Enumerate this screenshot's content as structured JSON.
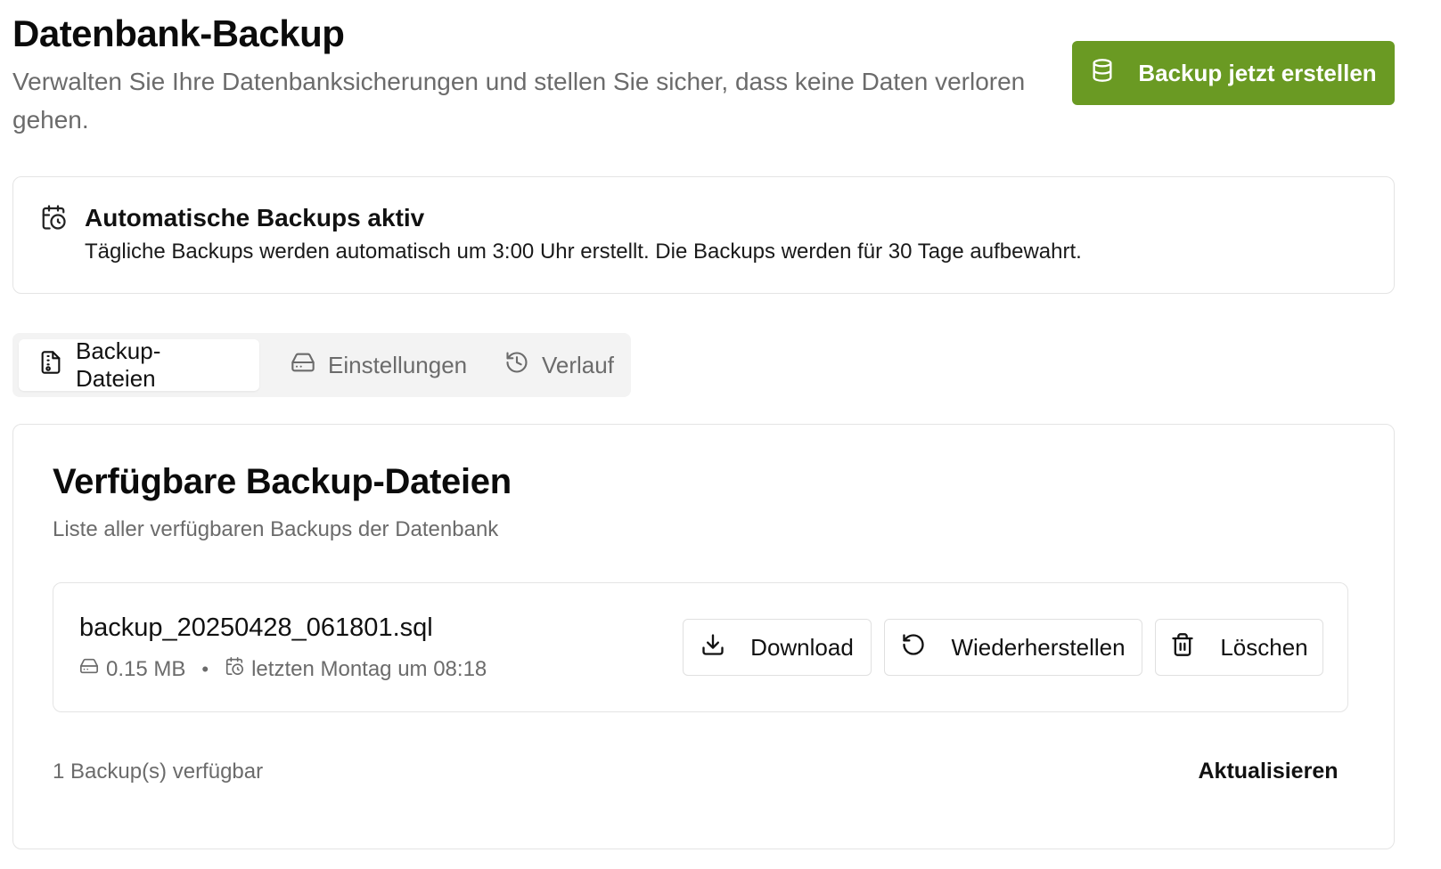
{
  "header": {
    "title": "Datenbank-Backup",
    "subtitle": "Verwalten Sie Ihre Datenbanksicherungen und stellen Sie sicher, dass keine Daten verloren gehen.",
    "create_button_label": "Backup jetzt erstellen",
    "create_button_icon": "database-icon",
    "accent_color": "#6a9a23"
  },
  "info": {
    "icon": "calendar-clock-icon",
    "title": "Automatische Backups aktiv",
    "text": "Tägliche Backups werden automatisch um 3:00 Uhr erstellt. Die Backups werden für 30 Tage aufbewahrt."
  },
  "tabs": [
    {
      "label": "Backup-Dateien",
      "icon": "file-archive-icon",
      "active": true
    },
    {
      "label": "Einstellungen",
      "icon": "hard-drive-icon",
      "active": false
    },
    {
      "label": "Verlauf",
      "icon": "history-icon",
      "active": false
    }
  ],
  "main": {
    "title": "Verfügbare Backup-Dateien",
    "subtitle": "Liste aller verfügbaren Backups der Datenbank",
    "files": [
      {
        "name": "backup_20250428_061801.sql",
        "size": "0.15 MB",
        "separator": "•",
        "date": "letzten Montag um 08:18",
        "actions": {
          "download": "Download",
          "restore": "Wiederherstellen",
          "delete": "Löschen"
        }
      }
    ],
    "count_text": "1 Backup(s) verfügbar",
    "refresh_label": "Aktualisieren"
  }
}
